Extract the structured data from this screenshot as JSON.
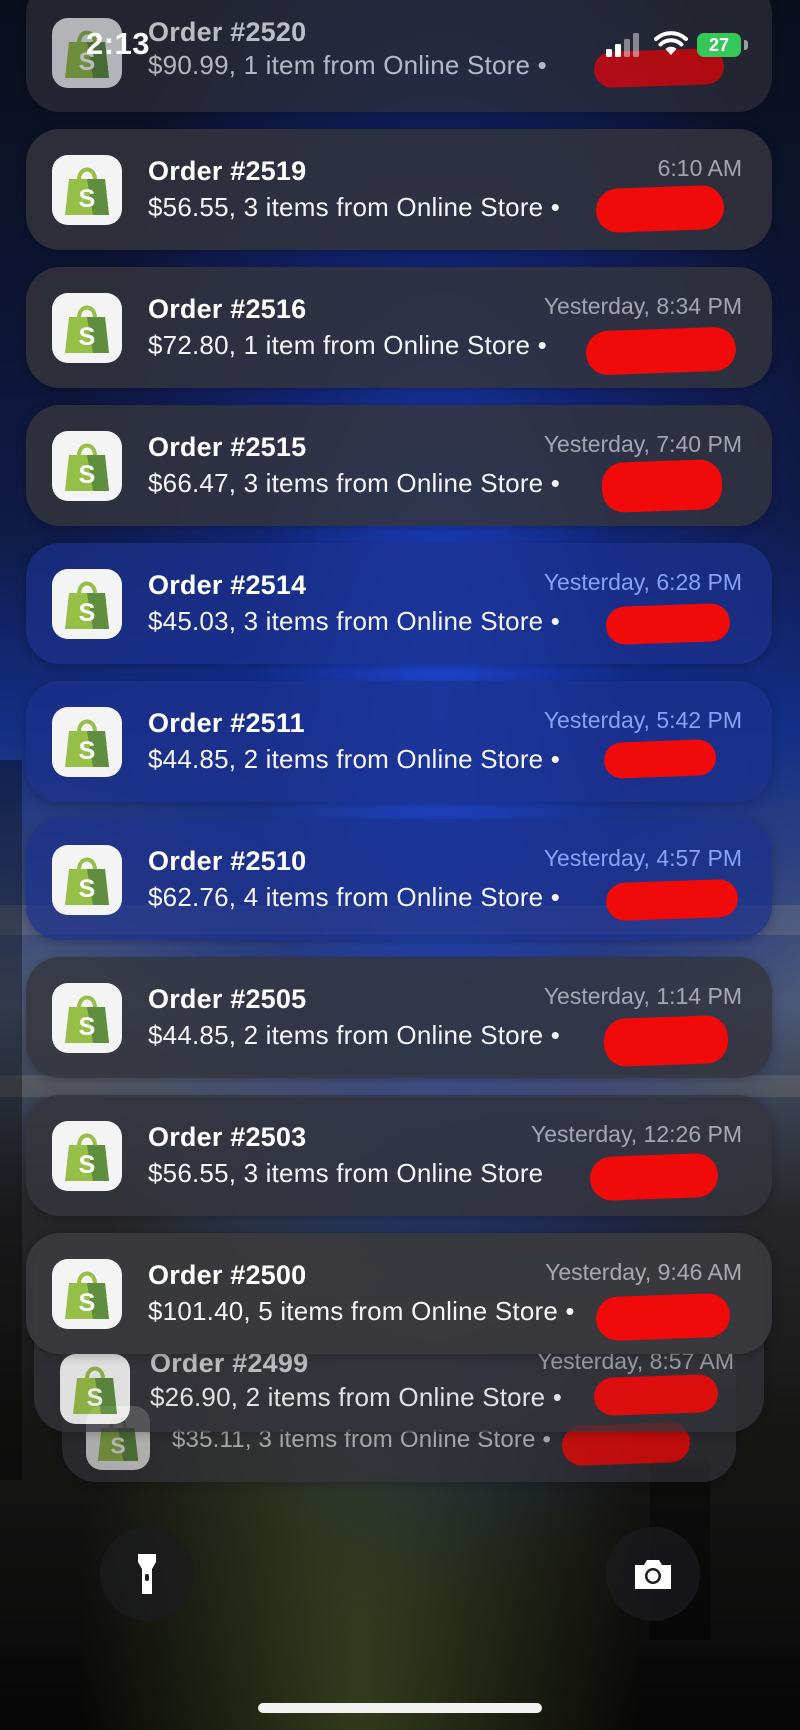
{
  "status_bar": {
    "time": "2:13",
    "battery_level": "27",
    "signal_icon": "cellular-signal-icon",
    "wifi_icon": "wifi-icon",
    "battery_icon": "battery-charging-icon"
  },
  "colors": {
    "shopify_green": "#95bf47",
    "redaction": "#f00a0a",
    "battery_green": "#35c759"
  },
  "notifications": [
    {
      "title": "Order #2520",
      "body": "$90.99, 1 item from Online Store •",
      "time": ""
    },
    {
      "title": "Order #2519",
      "body": "$56.55, 3 items from Online Store •",
      "time": "6:10 AM"
    },
    {
      "title": "Order #2516",
      "body": "$72.80, 1 item from Online Store •",
      "time": "Yesterday, 8:34 PM"
    },
    {
      "title": "Order #2515",
      "body": "$66.47, 3 items from Online Store •",
      "time": "Yesterday, 7:40 PM"
    },
    {
      "title": "Order #2514",
      "body": "$45.03, 3 items from Online Store •",
      "time": "Yesterday, 6:28 PM"
    },
    {
      "title": "Order #2511",
      "body": "$44.85, 2 items from Online Store •",
      "time": "Yesterday, 5:42 PM"
    },
    {
      "title": "Order #2510",
      "body": "$62.76, 4 items from Online Store •",
      "time": "Yesterday, 4:57 PM"
    },
    {
      "title": "Order #2505",
      "body": "$44.85, 2 items from Online Store •",
      "time": "Yesterday, 1:14 PM"
    },
    {
      "title": "Order #2503",
      "body": "$56.55, 3 items from Online Store",
      "time": "Yesterday, 12:26 PM"
    },
    {
      "title": "Order #2500",
      "body": "$101.40, 5 items from Online Store •",
      "time": "Yesterday, 9:46 AM"
    },
    {
      "title": "Order #2499",
      "body": "$26.90, 2 items from Online Store •",
      "time": "Yesterday, 8:57 AM"
    },
    {
      "title": "",
      "body": "$35.11, 3 items from Online Store •",
      "time": ""
    }
  ],
  "lock_screen": {
    "flashlight_icon": "flashlight-icon",
    "camera_icon": "camera-icon"
  }
}
